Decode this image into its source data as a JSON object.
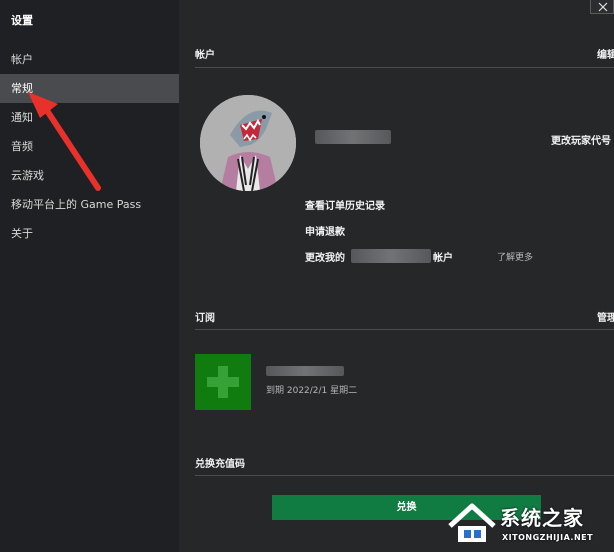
{
  "sidebar": {
    "title": "设置",
    "items": [
      {
        "label": "帐户",
        "active": false
      },
      {
        "label": "常规",
        "active": true
      },
      {
        "label": "通知",
        "active": false
      },
      {
        "label": "音频",
        "active": false
      },
      {
        "label": "云游戏",
        "active": false
      },
      {
        "label": "移动平台上的 Game Pass",
        "active": false
      },
      {
        "label": "关于",
        "active": false
      }
    ]
  },
  "account": {
    "title": "帐户",
    "edit_label": "编辑",
    "change_gamertag_label": "更改玩家代号",
    "order_history_label": "查看订单历史记录",
    "refund_label": "申请退款",
    "change_account_prefix": "更改我的",
    "change_account_suffix": "帐户",
    "learn_more_label": "了解更多"
  },
  "subscription": {
    "title": "订阅",
    "manage_label": "管理",
    "date_text": "到期 2022/2/1 星期二"
  },
  "redeem": {
    "title": "兑换充值码",
    "button_label": "兑换"
  },
  "watermark": {
    "brand": "系统之家",
    "site": "XITONGZHIJIA.NET"
  },
  "colors": {
    "sidebar_bg": "#1f2023",
    "main_bg": "#262729",
    "active_item": "#4a4b4e",
    "xbox_green": "#107c10",
    "button_green": "#107c41",
    "annotation_red": "#e8312a"
  },
  "icons": {
    "close": "close-icon",
    "game_pass": "game-pass-icon",
    "avatar": "shark-avatar"
  }
}
